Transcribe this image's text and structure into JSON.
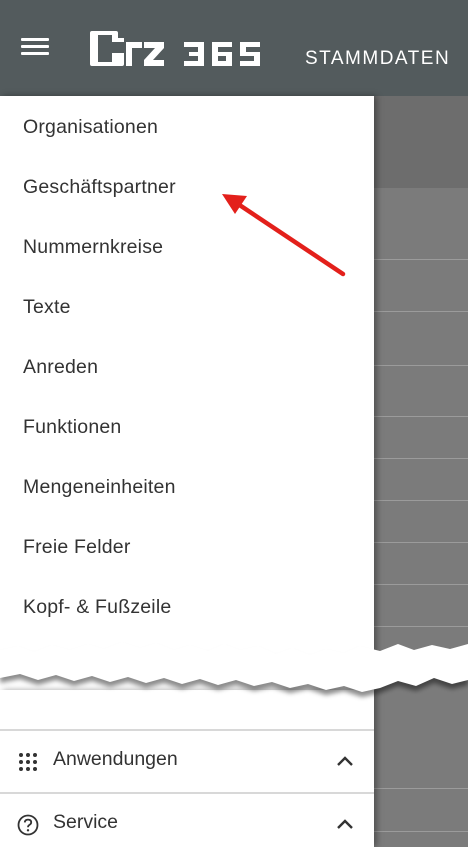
{
  "header": {
    "logo_text": "erz 365",
    "module_title": "STAMMDATEN",
    "menu_icon": "hamburger-menu-icon"
  },
  "nav": {
    "items": [
      {
        "label": "Organisationen"
      },
      {
        "label": "Geschäftspartner"
      },
      {
        "label": "Nummernkreise"
      },
      {
        "label": "Texte"
      },
      {
        "label": "Anreden"
      },
      {
        "label": "Funktionen"
      },
      {
        "label": "Mengeneinheiten"
      },
      {
        "label": "Freie Felder"
      },
      {
        "label": "Kopf- & Fußzeile"
      }
    ]
  },
  "sections": {
    "apps": {
      "label": "Anwendungen",
      "icon": "apps-grid-icon",
      "chevron": "chevron-up-icon"
    },
    "service": {
      "label": "Service",
      "icon": "help-circle-icon",
      "chevron": "chevron-up-icon"
    }
  },
  "annotation": {
    "arrow_color": "#e3201b"
  },
  "colors": {
    "appbar": "#535b5d",
    "backdrop": "#7b7b7b",
    "text": "#333333"
  }
}
